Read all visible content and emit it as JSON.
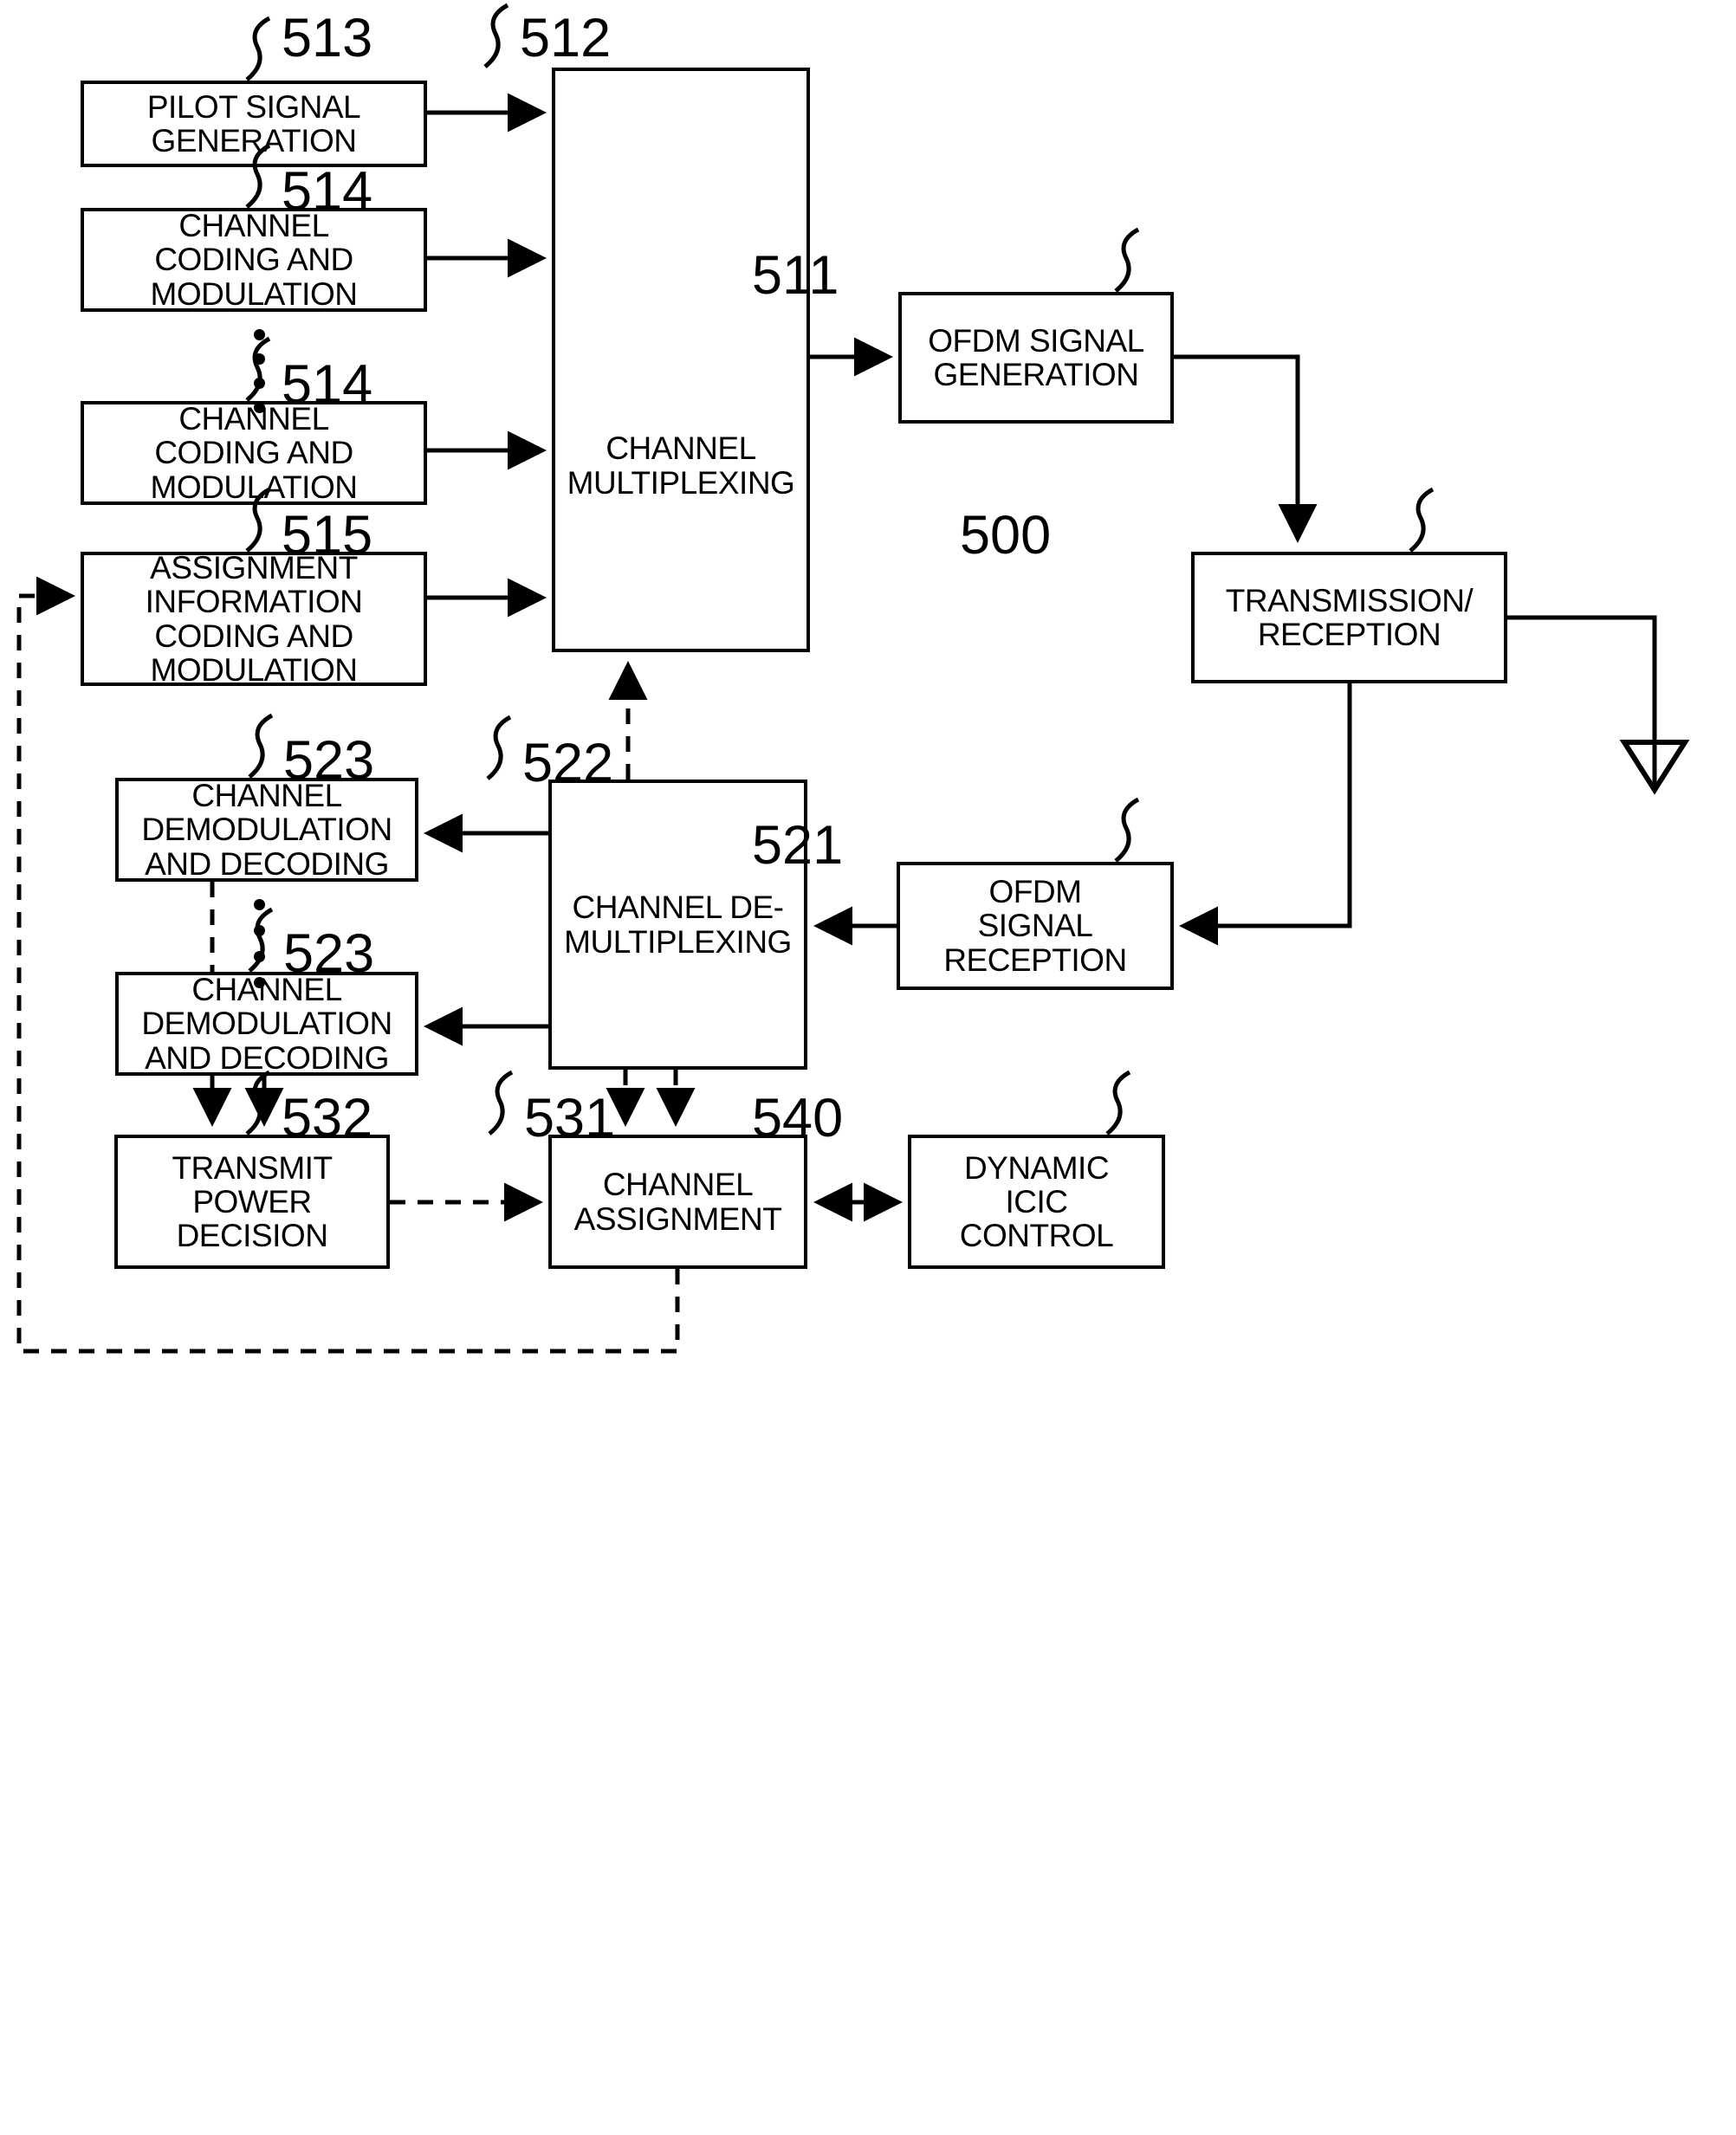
{
  "figure": {
    "type": "patent-block-diagram",
    "blocks": [
      {
        "id": "pilot_signal_generation",
        "ref": "513",
        "label": "PILOT SIGNAL\nGENERATION"
      },
      {
        "id": "channel_coding_modulation_1",
        "ref": "514",
        "label": "CHANNEL\nCODING AND\nMODULATION"
      },
      {
        "id": "channel_coding_modulation_2",
        "ref": "514",
        "label": "CHANNEL\nCODING AND\nMODULATION"
      },
      {
        "id": "assignment_information_coding_modulation",
        "ref": "515",
        "label": "ASSIGNMENT\nINFORMATION\nCODING AND\nMODULATION"
      },
      {
        "id": "channel_multiplexing",
        "ref": "512",
        "label": "CHANNEL\nMULTIPLEXING"
      },
      {
        "id": "ofdm_signal_generation",
        "ref": "511",
        "label": "OFDM SIGNAL\nGENERATION"
      },
      {
        "id": "transmission_reception",
        "ref": "500",
        "label": "TRANSMISSION/\nRECEPTION"
      },
      {
        "id": "channel_demodulation_decoding_1",
        "ref": "523",
        "label": "CHANNEL\nDEMODULATION\nAND DECODING"
      },
      {
        "id": "channel_demodulation_decoding_2",
        "ref": "523",
        "label": "CHANNEL\nDEMODULATION\nAND DECODING"
      },
      {
        "id": "channel_demultiplexing",
        "ref": "522",
        "label": "CHANNEL DE-\nMULTIPLEXING"
      },
      {
        "id": "ofdm_signal_reception",
        "ref": "521",
        "label": "OFDM\nSIGNAL\nRECEPTION"
      },
      {
        "id": "transmit_power_decision",
        "ref": "532",
        "label": "TRANSMIT\nPOWER\nDECISION"
      },
      {
        "id": "channel_assignment",
        "ref": "531",
        "label": "CHANNEL\nASSIGNMENT"
      },
      {
        "id": "dynamic_icic_control",
        "ref": "540",
        "label": "DYNAMIC\nICIC\nCONTROL"
      }
    ],
    "antenna": {
      "name": "antenna-symbol"
    },
    "colors": {
      "line": "#000000",
      "background": "#ffffff"
    }
  }
}
